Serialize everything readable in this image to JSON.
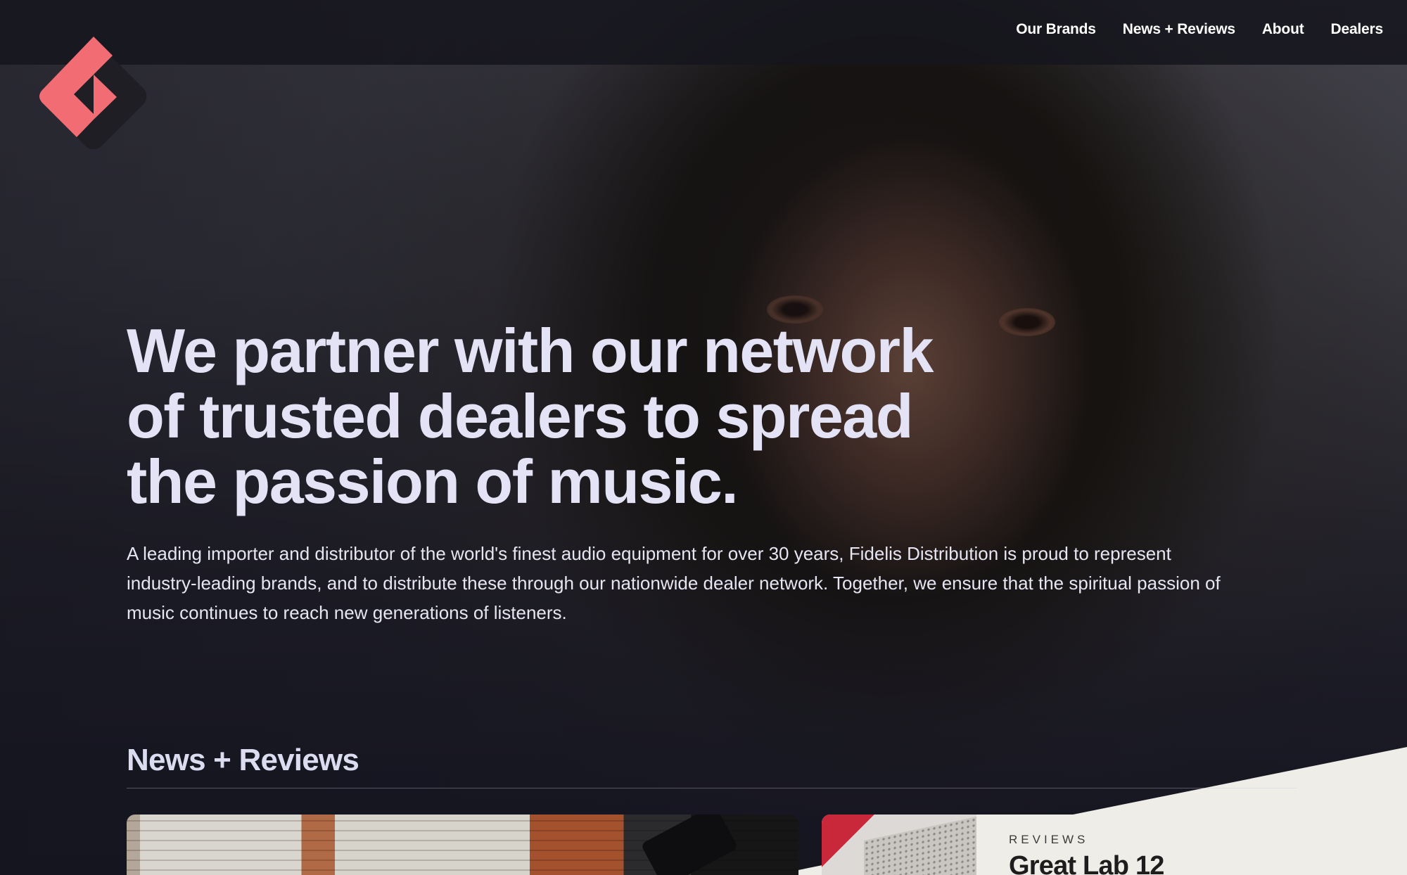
{
  "nav": {
    "items": [
      {
        "label": "Our Brands"
      },
      {
        "label": "News + Reviews"
      },
      {
        "label": "About"
      },
      {
        "label": "Dealers"
      }
    ]
  },
  "brand": {
    "logo_icon": "fidelis-logo-icon",
    "accent_color": "#f26d73"
  },
  "hero": {
    "headline_lines": [
      "We partner with our network",
      "of trusted dealers to spread",
      "the passion of music."
    ],
    "intro_lines": [
      "A leading importer and distributor of the world's finest audio equipment for over 30 years, Fidelis Distribution is proud to represent",
      "industry-leading brands, and to distribute these through our nationwide dealer network. Together, we ensure that the spiritual passion of",
      "music continues to reach new generations of listeners."
    ]
  },
  "news": {
    "section_title": "News + Reviews",
    "review_card": {
      "tag": "REVIEWS",
      "title": "Great Lab 12"
    }
  }
}
